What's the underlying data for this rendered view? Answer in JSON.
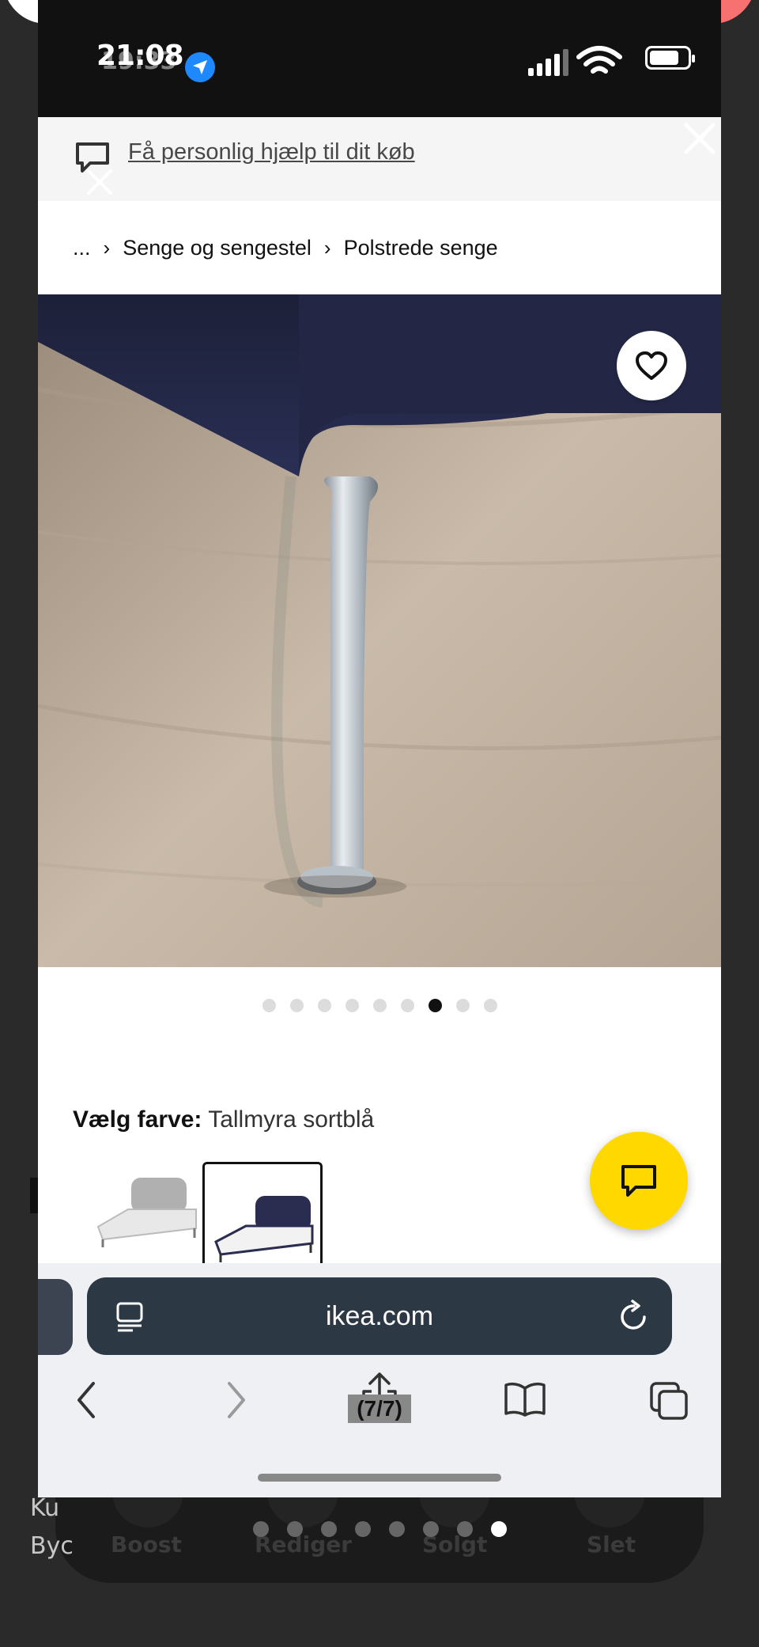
{
  "status_bar": {
    "time": "21:08",
    "time_overlay": "19:33"
  },
  "help_banner": {
    "link_text": "Få personlig hjælp til dit køb"
  },
  "breadcrumb": {
    "items": [
      "...",
      "Senge og sengestel",
      "Polstrede senge"
    ]
  },
  "carousel": {
    "total": 9,
    "active_index": 6
  },
  "color_selector": {
    "label": "Vælg farve:",
    "value": "Tallmyra sortblå",
    "swatches": [
      "light-grey-bed",
      "dark-blue-bed"
    ],
    "selected_index": 1
  },
  "safari": {
    "url": "ikea.com",
    "tab_counter": "(7/7)"
  },
  "background_app": {
    "actions": [
      "Boost",
      "Rediger",
      "Solgt",
      "Slet"
    ],
    "left_text": [
      "Ku",
      "Byc"
    ],
    "page_dots_total": 8,
    "page_dots_active": 7
  },
  "colors": {
    "ikea_yellow": "#ffd800",
    "safari_url_bar": "#2d3845"
  }
}
